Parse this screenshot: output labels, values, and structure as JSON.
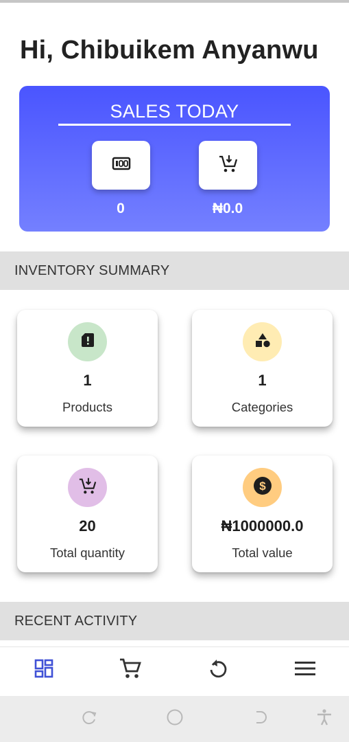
{
  "greeting": "Hi, Chibuikem Anyanwu",
  "sales_today": {
    "title": "SALES TODAY",
    "items": [
      {
        "icon": "receipt-counter-icon",
        "value": "0"
      },
      {
        "icon": "cart-down-icon",
        "value": "₦0.0"
      }
    ]
  },
  "inventory_summary": {
    "title": "INVENTORY SUMMARY",
    "cards": [
      {
        "icon": "sim-card-alert-icon",
        "icon_bg": "#c8e6c9",
        "value": "1",
        "label": "Products"
      },
      {
        "icon": "shapes-category-icon",
        "icon_bg": "#ffecb3",
        "value": "1",
        "label": "Categories"
      },
      {
        "icon": "cart-down-icon",
        "icon_bg": "#e1bee7",
        "value": "20",
        "label": "Total quantity"
      },
      {
        "icon": "dollar-coin-icon",
        "icon_bg": "#ffcc80",
        "value": "₦1000000.0",
        "label": "Total value"
      }
    ]
  },
  "recent_activity": {
    "title": "RECENT ACTIVITY"
  },
  "bottom_nav": [
    {
      "icon": "dashboard-icon",
      "active": true
    },
    {
      "icon": "shopping-cart-icon",
      "active": false
    },
    {
      "icon": "refresh-icon",
      "active": false
    },
    {
      "icon": "menu-icon",
      "active": false
    }
  ],
  "system_nav": [
    "recents-icon",
    "home-icon",
    "back-icon",
    "accessibility-icon"
  ],
  "colors": {
    "accent": "#4a55ff",
    "nav_active": "#3f51d6",
    "section_bg": "#e0e0e0"
  }
}
